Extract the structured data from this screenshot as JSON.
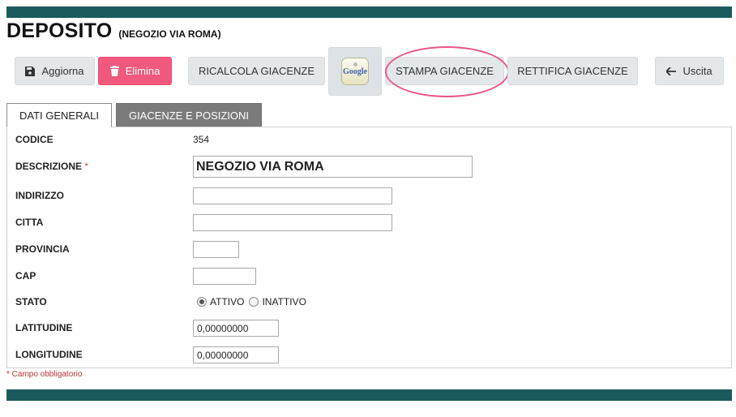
{
  "header": {
    "title": "DEPOSITO",
    "subtitle": "(NEGOZIO VIA ROMA)"
  },
  "toolbar": {
    "aggiorna_label": "Aggiorna",
    "elimina_label": "Elimina",
    "ricalcola_label": "RICALCOLA GIACENZE",
    "google_logo_text": "Google",
    "stampa_label": "STAMPA GIACENZE",
    "rettifica_label": "RETTIFICA GIACENZE",
    "uscita_label": "Uscita"
  },
  "tabs": [
    {
      "label": "DATI GENERALI",
      "active": true
    },
    {
      "label": "GIACENZE E POSIZIONI",
      "active": false
    }
  ],
  "form": {
    "codice": {
      "label": "CODICE",
      "value": "354"
    },
    "descrizione": {
      "label": "DESCRIZIONE",
      "required_mark": "*",
      "value": "NEGOZIO VIA ROMA"
    },
    "indirizzo": {
      "label": "INDIRIZZO",
      "value": ""
    },
    "citta": {
      "label": "CITTA",
      "value": ""
    },
    "provincia": {
      "label": "PROVINCIA",
      "value": ""
    },
    "cap": {
      "label": "CAP",
      "value": ""
    },
    "stato": {
      "label": "STATO",
      "options": [
        "ATTIVO",
        "INATTIVO"
      ],
      "selected": "ATTIVO"
    },
    "latitudine": {
      "label": "LATITUDINE",
      "value": "0,00000000"
    },
    "longitudine": {
      "label": "LONGITUDINE",
      "value": "0,00000000"
    }
  },
  "footnote": "* Campo obbligatorio",
  "colors": {
    "bar": "#1b5a5c",
    "danger": "#f0597d",
    "highlight": "#e8568a",
    "tab_inactive": "#7b7b7b"
  },
  "icons": [
    "save-icon",
    "trash-icon",
    "google-maps-icon",
    "arrow-left-icon"
  ]
}
